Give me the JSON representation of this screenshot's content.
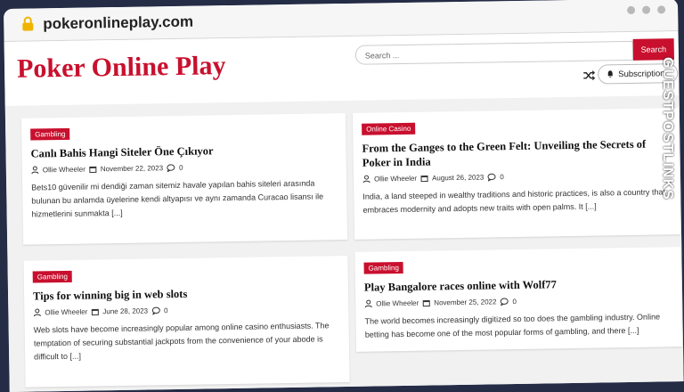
{
  "browser": {
    "url": "pokeronlineplay.com"
  },
  "header": {
    "brand": "Poker Online Play",
    "search_placeholder": "Search ...",
    "search_button": "Search",
    "subscription_label": "Subscription"
  },
  "posts": [
    {
      "category": "Gambling",
      "title": "Canlı Bahis Hangi Siteler Öne Çıkıyor",
      "author": "Ollie Wheeler",
      "date": "November 22, 2023",
      "comments": "0",
      "excerpt": "Bets10 güvenilir mi dendiği zaman sitemiz havale yapılan bahis siteleri arasında bulunan bu anlamda üyelerine kendi altyapısı ve aynı zamanda Curacao lisansı ile hizmetlerini sunmakta [...]"
    },
    {
      "category": "Online Casino",
      "title": "From the Ganges to the Green Felt: Unveiling the Secrets of Poker in India",
      "author": "Ollie Wheeler",
      "date": "August 26, 2023",
      "comments": "0",
      "excerpt": "India, a land steeped in wealthy traditions and historic practices, is also a country that embraces modernity and adopts new traits with open palms. It [...]"
    },
    {
      "category": "Gambling",
      "title": "Tips for winning big in web slots",
      "author": "Ollie Wheeler",
      "date": "June 28, 2023",
      "comments": "0",
      "excerpt": "Web slots have become increasingly popular among online casino enthusiasts. The temptation of securing substantial jackpots from the convenience of your abode is difficult to [...]"
    },
    {
      "category": "Gambling",
      "title": "Play Bangalore races online with Wolf77",
      "author": "Ollie Wheeler",
      "date": "November 25, 2022",
      "comments": "0",
      "excerpt": "The world becomes increasingly digitized so too does the gambling industry. Online betting has become one of the most popular forms of gambling, and there [...]"
    }
  ],
  "watermark": {
    "text": "GUESTPOSTLINKS"
  },
  "colors": {
    "accent": "#c8102e",
    "frame": "#242c46"
  }
}
